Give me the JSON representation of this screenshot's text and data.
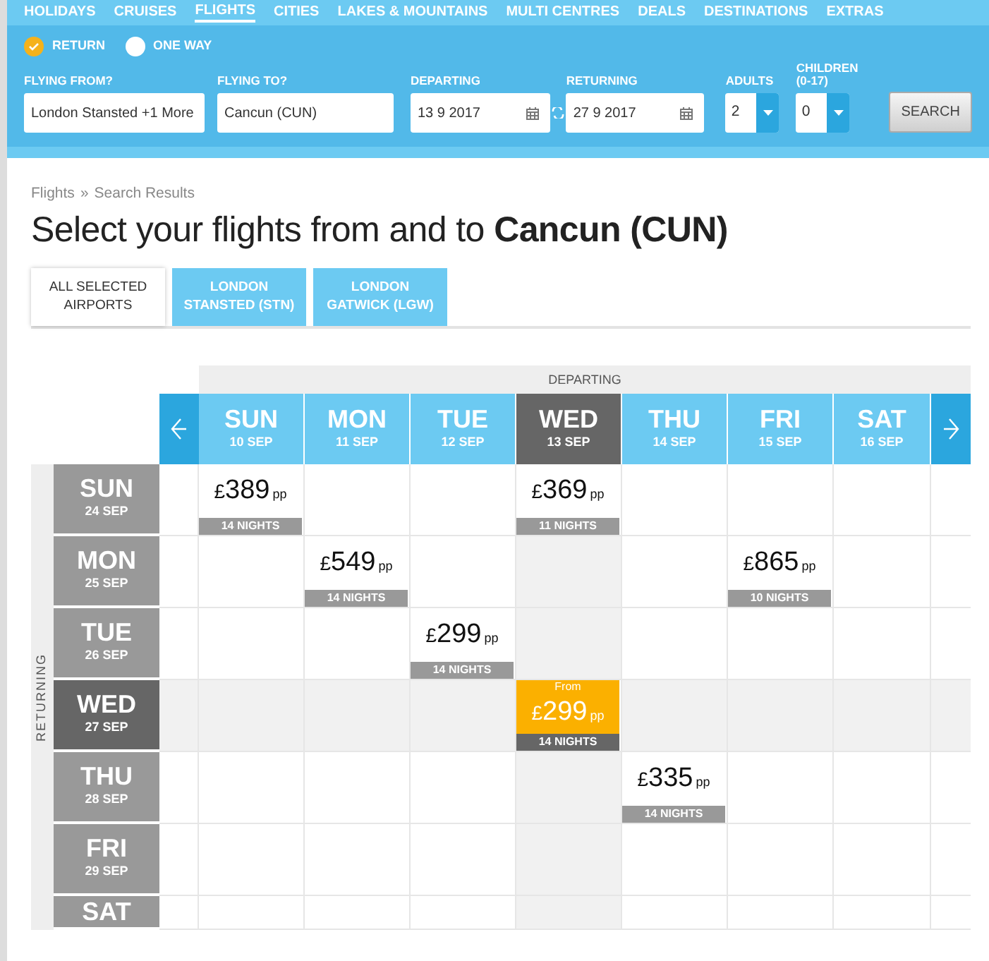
{
  "nav": [
    {
      "label": "HOLIDAYS",
      "selected": false
    },
    {
      "label": "CRUISES",
      "selected": false
    },
    {
      "label": "FLIGHTS",
      "selected": true
    },
    {
      "label": "CITIES",
      "selected": false
    },
    {
      "label": "LAKES & MOUNTAINS",
      "selected": false
    },
    {
      "label": "MULTI CENTRES",
      "selected": false
    },
    {
      "label": "DEALS",
      "selected": false
    },
    {
      "label": "DESTINATIONS",
      "selected": false
    },
    {
      "label": "EXTRAS",
      "selected": false
    }
  ],
  "search": {
    "trip_options": [
      {
        "label": "RETURN",
        "selected": true
      },
      {
        "label": "ONE WAY",
        "selected": false
      }
    ],
    "fields": [
      {
        "kind": "text",
        "label": "FLYING FROM?",
        "value": "London Stansted +1 More"
      },
      {
        "kind": "text",
        "label": "FLYING TO?",
        "value": "Cancun (CUN)"
      },
      {
        "kind": "date",
        "label": "DEPARTING",
        "value": "13 9 2017"
      },
      {
        "kind": "date",
        "label": "RETURNING",
        "value": "27 9 2017"
      },
      {
        "kind": "select",
        "label": "ADULTS",
        "value": "2"
      },
      {
        "kind": "select",
        "label": "CHILDREN",
        "sublabel": "(0-17)",
        "value": "0"
      }
    ],
    "button": "SEARCH"
  },
  "breadcrumb": {
    "items": [
      "Flights",
      "Search Results"
    ],
    "separator": "»"
  },
  "title": "Select your flights from and to **Cancun (CUN)**",
  "airport_tabs": [
    {
      "label": "ALL SELECTED AIRPORTS",
      "selected": true
    },
    {
      "label": "LONDON STANSTED (STN)",
      "selected": false
    },
    {
      "label": "LONDON GATWICK (LGW)",
      "selected": false
    }
  ],
  "grid": {
    "departing_label": "DEPARTING",
    "returning_label": "RETURNING",
    "departing_days": [
      {
        "day": "SUN",
        "date": "10 SEP",
        "selected": false
      },
      {
        "day": "MON",
        "date": "11 SEP",
        "selected": false
      },
      {
        "day": "TUE",
        "date": "12 SEP",
        "selected": false
      },
      {
        "day": "WED",
        "date": "13 SEP",
        "selected": true
      },
      {
        "day": "THU",
        "date": "14 SEP",
        "selected": false
      },
      {
        "day": "FRI",
        "date": "15 SEP",
        "selected": false
      },
      {
        "day": "SAT",
        "date": "16 SEP",
        "selected": false
      }
    ],
    "returning_days": [
      {
        "day": "SUN",
        "date": "24 SEP",
        "selected": false,
        "cells": [
          {
            "currency": "£",
            "price": "389",
            "unit": "pp",
            "nights": "14 NIGHTS"
          },
          null,
          null,
          {
            "currency": "£",
            "price": "369",
            "unit": "pp",
            "nights": "11 NIGHTS"
          },
          null,
          null,
          null
        ]
      },
      {
        "day": "MON",
        "date": "25 SEP",
        "selected": false,
        "cells": [
          null,
          {
            "currency": "£",
            "price": "549",
            "unit": "pp",
            "nights": "14 NIGHTS"
          },
          null,
          null,
          null,
          {
            "currency": "£",
            "price": "865",
            "unit": "pp",
            "nights": "10 NIGHTS"
          },
          null
        ]
      },
      {
        "day": "TUE",
        "date": "26 SEP",
        "selected": false,
        "cells": [
          null,
          null,
          {
            "currency": "£",
            "price": "299",
            "unit": "pp",
            "nights": "14 NIGHTS"
          },
          null,
          null,
          null,
          null
        ]
      },
      {
        "day": "WED",
        "date": "27 SEP",
        "selected": true,
        "cells": [
          null,
          null,
          null,
          {
            "from": "From",
            "currency": "£",
            "price": "299",
            "unit": "pp",
            "nights": "14 NIGHTS"
          },
          null,
          null,
          null
        ]
      },
      {
        "day": "THU",
        "date": "28 SEP",
        "selected": false,
        "cells": [
          null,
          null,
          null,
          null,
          {
            "currency": "£",
            "price": "335",
            "unit": "pp",
            "nights": "14 NIGHTS"
          },
          null,
          null
        ]
      },
      {
        "day": "FRI",
        "date": "29 SEP",
        "selected": false,
        "cells": [
          null,
          null,
          null,
          null,
          null,
          null,
          null
        ]
      },
      {
        "day": "SAT",
        "selected": false,
        "cells": [
          null,
          null,
          null,
          null,
          null,
          null,
          null
        ]
      }
    ]
  }
}
